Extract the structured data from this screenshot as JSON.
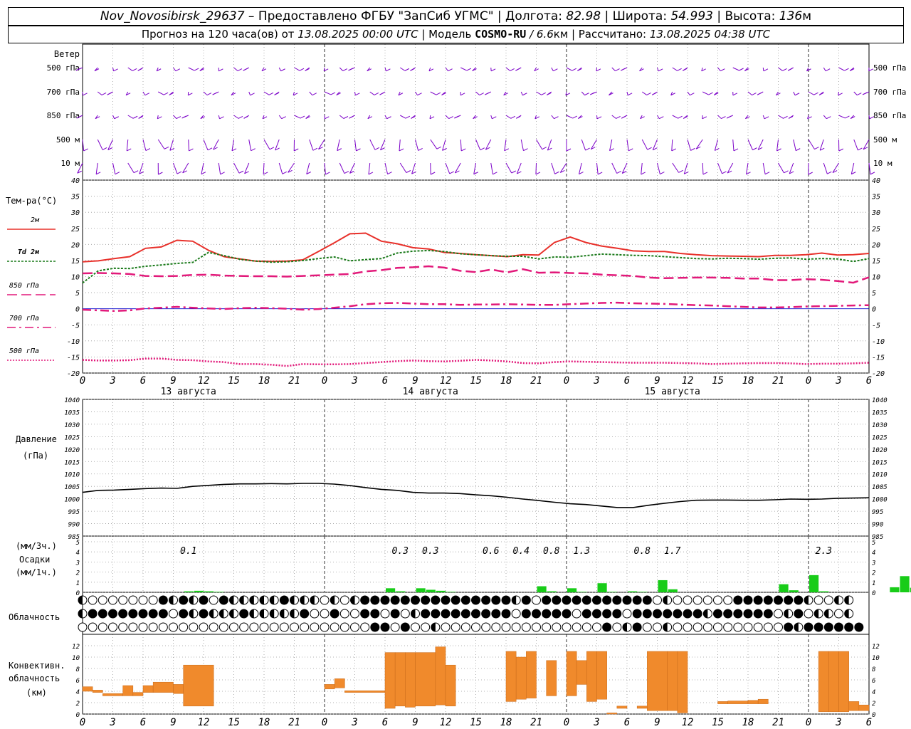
{
  "header": {
    "station": "Nov_Novosibirsk_29637",
    "provider": " – Предоставлено ФГБУ \"ЗапСиб УГМС\" | Долгота: ",
    "lon": "82.98",
    "lat_label": " | Широта: ",
    "lat": "54.993",
    "alt_label": " | Высота: ",
    "alt": "136",
    "alt_unit": "м",
    "line2_a": "Прогноз на 120 часа(ов) от ",
    "forecast_start": "13.08.2025 00:00 UTC",
    "line2_b": "  | Модель ",
    "model": "COSMO-RU",
    "line2_c": " / 6.6",
    "res_unit": "км",
    "line2_d": " | Рассчитано: ",
    "computed": "13.08.2025 04:38 UTC"
  },
  "wind_panel": {
    "title": "Ветер",
    "levels": [
      "500 гПа",
      "700 гПа",
      "850 гПа",
      "500 м",
      "10  м"
    ],
    "color": "#7b00c8"
  },
  "time_axis": {
    "tick_labels": [
      "0",
      "3",
      "6",
      "9",
      "12",
      "15",
      "18",
      "21",
      "0",
      "3",
      "6",
      "9",
      "12",
      "15",
      "18",
      "21",
      "0",
      "3",
      "6",
      "9",
      "12",
      "15",
      "18",
      "21",
      "0",
      "3",
      "6"
    ],
    "dates": [
      "13 августа",
      "14 августа",
      "15 августа"
    ]
  },
  "chart_data": [
    {
      "type": "line",
      "title": "Тем-ра(°C)",
      "x_hours": [
        0,
        6,
        12,
        18,
        24,
        30,
        36,
        42,
        48,
        54,
        60,
        66,
        72,
        78,
        84,
        90,
        96,
        102,
        108,
        114,
        120,
        126,
        132,
        138,
        144,
        150,
        156,
        162,
        168,
        174,
        180,
        186,
        192,
        198,
        204,
        210,
        216,
        222,
        228,
        234,
        240,
        246,
        252,
        258,
        264,
        270,
        276,
        282,
        288,
        294,
        300
      ],
      "ylim": [
        -20,
        40
      ],
      "yticks": [
        -20,
        -15,
        -10,
        -5,
        0,
        5,
        10,
        15,
        20,
        25,
        30,
        35,
        40
      ],
      "series": [
        {
          "name": "2м",
          "color": "#e8302a",
          "dash": "solid",
          "values": [
            14.6,
            14.9,
            15.6,
            16.2,
            18.8,
            19.2,
            21.3,
            21,
            18.2,
            16.2,
            15.5,
            14.8,
            14.7,
            14.8,
            15.2,
            17.8,
            20.5,
            23.3,
            23.5,
            21,
            20.2,
            19,
            18.6,
            17.5,
            17.2,
            16.8,
            16.5,
            16.2,
            16.8,
            16.7,
            20.6,
            22.3,
            20.6,
            19.5,
            18.8,
            18,
            17.8,
            17.8,
            17.2,
            16.8,
            16.5,
            16.4,
            16.3,
            16.2,
            16.6,
            16.6,
            16.8,
            17.3,
            16.7,
            16.8,
            17.2
          ]
        },
        {
          "name": "Td 2м",
          "color": "#1a7a1a",
          "dash": "dashed",
          "values": [
            8,
            11.8,
            12.6,
            12.5,
            13.2,
            13.6,
            14.1,
            14.4,
            17.5,
            16.5,
            15.4,
            14.8,
            14.5,
            14.6,
            15,
            15.6,
            16.1,
            14.9,
            15.3,
            15.6,
            17.3,
            17.9,
            18.1,
            17.8,
            17.1,
            16.8,
            16.5,
            16.3,
            16.3,
            15.5,
            16.1,
            16,
            16.5,
            17,
            16.8,
            16.6,
            16.5,
            16.2,
            15.9,
            15.6,
            15.5,
            15.7,
            15.6,
            15.4,
            15.7,
            15.8,
            15.4,
            15.6,
            15.5,
            14.7,
            15.6
          ]
        },
        {
          "name": "850 гПа",
          "color": "#e2197a",
          "dash": "longdash",
          "values": [
            11,
            11.1,
            11,
            10.8,
            10.2,
            10.1,
            10.2,
            10.5,
            10.6,
            10.3,
            10.2,
            10.1,
            10.1,
            10,
            10.2,
            10.4,
            10.6,
            10.8,
            11.6,
            12,
            12.7,
            12.9,
            13.2,
            12.8,
            11.8,
            11.4,
            12.2,
            11.3,
            12.3,
            11.2,
            11.3,
            11.1,
            11,
            10.6,
            10.4,
            10.2,
            9.7,
            9.5,
            9.6,
            9.7,
            9.7,
            9.6,
            9.4,
            9.4,
            8.9,
            8.9,
            9.2,
            9,
            8.6,
            8.1,
            9.8
          ]
        },
        {
          "name": "700 гПа",
          "color": "#e2197a",
          "dash": "dashdot",
          "values": [
            -0.3,
            -0.5,
            -0.7,
            -0.5,
            0.1,
            0.3,
            0.6,
            0.3,
            0.1,
            -0.1,
            0.2,
            0.3,
            0.2,
            0,
            -0.3,
            -0.1,
            0.3,
            0.8,
            1.4,
            1.7,
            1.8,
            1.6,
            1.4,
            1.4,
            1.2,
            1.3,
            1.3,
            1.4,
            1.3,
            1.2,
            1.2,
            1.4,
            1.6,
            1.8,
            1.9,
            1.7,
            1.6,
            1.5,
            1.3,
            1.1,
            1,
            0.8,
            0.6,
            0.4,
            0.4,
            0.5,
            0.7,
            0.8,
            0.9,
            1,
            1.1
          ]
        },
        {
          "name": "500 гПа",
          "color": "#e2197a",
          "dash": "dotted",
          "values": [
            -15.9,
            -16.1,
            -16.1,
            -16,
            -15.5,
            -15.5,
            -15.9,
            -16,
            -16.4,
            -16.6,
            -17.2,
            -17.2,
            -17.4,
            -17.8,
            -17.2,
            -17.3,
            -17.3,
            -17.2,
            -16.9,
            -16.6,
            -16.3,
            -16.1,
            -16.3,
            -16.4,
            -16.2,
            -15.9,
            -16.1,
            -16.4,
            -16.9,
            -17,
            -16.6,
            -16.4,
            -16.5,
            -16.6,
            -16.7,
            -16.8,
            -16.8,
            -16.8,
            -16.9,
            -17,
            -17.2,
            -17.1,
            -17,
            -16.9,
            -16.9,
            -17,
            -17.2,
            -17.1,
            -17.1,
            -17,
            -16.8
          ]
        }
      ]
    },
    {
      "type": "line",
      "title": "Давление",
      "ylabel": "(гПа)",
      "x_hours": [
        0,
        6,
        12,
        18,
        24,
        30,
        36,
        42,
        48,
        54,
        60,
        66,
        72,
        78,
        84,
        90,
        96,
        102,
        108,
        114,
        120,
        126,
        132,
        138,
        144,
        150,
        156,
        162,
        168,
        174,
        180,
        186,
        192,
        198,
        204,
        210,
        216,
        222,
        228,
        234,
        240,
        246,
        252,
        258,
        264,
        270,
        276,
        282,
        288,
        294,
        300
      ],
      "ylim": [
        985,
        1040
      ],
      "yticks": [
        985,
        990,
        995,
        1000,
        1005,
        1010,
        1015,
        1020,
        1025,
        1030,
        1035,
        1040
      ],
      "series": [
        {
          "name": "",
          "color": "#000000",
          "values": [
            1002.6,
            1003.4,
            1003.5,
            1003.8,
            1004.1,
            1004.3,
            1004.2,
            1005,
            1005.4,
            1005.8,
            1006,
            1006,
            1006.1,
            1006,
            1006.2,
            1006.2,
            1005.9,
            1005.3,
            1004.5,
            1003.8,
            1003.4,
            1002.6,
            1002.3,
            1002.3,
            1002.1,
            1001.6,
            1001.2,
            1000.6,
            999.9,
            999.3,
            998.6,
            998,
            997.7,
            997.1,
            996.5,
            996.5,
            997.4,
            998.2,
            998.9,
            999.4,
            999.5,
            999.5,
            999.4,
            999.4,
            999.6,
            999.9,
            999.8,
            999.9,
            1000.2,
            1000.3,
            1000.4
          ]
        }
      ]
    },
    {
      "type": "bar",
      "title": "Осадки",
      "ylabel": "(мм/3ч.) (мм/1ч.)",
      "ylim": [
        0,
        5
      ],
      "yticks": [
        0,
        1,
        2,
        3,
        4,
        5
      ],
      "color": "#18cc18",
      "bars_hours": [
        10,
        11,
        12,
        13,
        30,
        31,
        33,
        34,
        35,
        36,
        45,
        46,
        48,
        49,
        51,
        52,
        54,
        55,
        57,
        58,
        69,
        70,
        72,
        73,
        80,
        81,
        82,
        83,
        90,
        91,
        93,
        94,
        96,
        97,
        99,
        100
      ],
      "bars_values": [
        0.1,
        0.15,
        0.1,
        0.05,
        0.4,
        0.1,
        0.4,
        0.25,
        0.15,
        0.05,
        0.6,
        0.1,
        0.4,
        0.05,
        0.9,
        0.05,
        0.1,
        0.05,
        1.2,
        0.3,
        0.8,
        0.2,
        1.7,
        0.1,
        0.5,
        1.6,
        0.45,
        0.1,
        0.2,
        0.1,
        0.05,
        0.05,
        0.05,
        0.05,
        0.05,
        0.05
      ],
      "labels_3h": [
        {
          "hour": 10.5,
          "text": "0.1"
        },
        {
          "hour": 31.5,
          "text": "0.3"
        },
        {
          "hour": 34.5,
          "text": "0.3"
        },
        {
          "hour": 40.5,
          "text": "0.6"
        },
        {
          "hour": 43.5,
          "text": "0.4"
        },
        {
          "hour": 46.5,
          "text": "0.8"
        },
        {
          "hour": 49.5,
          "text": "1.3"
        },
        {
          "hour": 55.5,
          "text": "0.8"
        },
        {
          "hour": 58.5,
          "text": "1.7"
        },
        {
          "hour": 73.5,
          "text": "2.3"
        }
      ]
    },
    {
      "type": "bar",
      "title": "Конвективн. облачность",
      "ylabel": "(км)",
      "ylim": [
        0,
        13
      ],
      "yticks": [
        0,
        2,
        4,
        6,
        8,
        10,
        12
      ],
      "color": "#f08a2c",
      "segments_hours": [
        [
          0,
          1
        ],
        [
          1,
          2
        ],
        [
          2,
          4
        ],
        [
          4,
          5
        ],
        [
          5,
          6
        ],
        [
          6,
          7
        ],
        [
          7,
          9
        ],
        [
          9,
          10
        ],
        [
          10,
          13
        ],
        [
          24,
          25
        ],
        [
          25,
          26
        ],
        [
          26,
          30
        ],
        [
          30,
          31
        ],
        [
          31,
          32
        ],
        [
          32,
          33
        ],
        [
          33,
          35
        ],
        [
          35,
          36
        ],
        [
          36,
          37
        ],
        [
          42,
          43
        ],
        [
          43,
          44
        ],
        [
          44,
          45
        ],
        [
          46,
          47
        ],
        [
          48,
          49
        ],
        [
          49,
          50
        ],
        [
          50,
          51
        ],
        [
          51,
          52
        ],
        [
          52,
          53
        ],
        [
          53,
          54
        ],
        [
          55,
          56
        ],
        [
          56,
          58
        ],
        [
          58,
          59
        ],
        [
          59,
          60
        ],
        [
          63,
          64
        ],
        [
          64,
          66
        ],
        [
          66,
          67
        ],
        [
          67,
          68
        ],
        [
          73,
          74
        ],
        [
          74,
          75
        ],
        [
          75,
          76
        ],
        [
          76,
          77
        ],
        [
          77,
          78
        ]
      ],
      "segments_km": [
        [
          4,
          4.8
        ],
        [
          3.8,
          4.2
        ],
        [
          3.2,
          3.6
        ],
        [
          3.2,
          5
        ],
        [
          3.2,
          3.8
        ],
        [
          3.8,
          5
        ],
        [
          3.8,
          5.6
        ],
        [
          3.6,
          5.2
        ],
        [
          1.4,
          8.6
        ],
        [
          4.4,
          5.2
        ],
        [
          4.6,
          6.2
        ],
        [
          3.8,
          4.1
        ],
        [
          1,
          10.8
        ],
        [
          1.4,
          10.8
        ],
        [
          1.2,
          10.8
        ],
        [
          1.4,
          10.8
        ],
        [
          1.6,
          11.8
        ],
        [
          1.4,
          8.6
        ],
        [
          2.2,
          11
        ],
        [
          2.6,
          10
        ],
        [
          2.8,
          11
        ],
        [
          3.2,
          9.4
        ],
        [
          3.2,
          11
        ],
        [
          5.2,
          9.4
        ],
        [
          2.2,
          11
        ],
        [
          2.6,
          11
        ],
        [
          0,
          0.2
        ],
        [
          1,
          1.4
        ],
        [
          1,
          1.4
        ],
        [
          0.6,
          11
        ],
        [
          0.6,
          11
        ],
        [
          0.2,
          11
        ],
        [
          1.8,
          2.2
        ],
        [
          1.8,
          2.3
        ],
        [
          1.8,
          2.4
        ],
        [
          1.8,
          2.6
        ],
        [
          0.4,
          11
        ],
        [
          0.4,
          11
        ],
        [
          0.4,
          11
        ],
        [
          0.6,
          2.2
        ],
        [
          0.6,
          1.6
        ]
      ]
    }
  ],
  "cloudiness": {
    "title": "Облачность",
    "rows": [
      "hqqqqqqqfhfhfqfhhhhhfhhhqhqhfffffffffffffffhfqfffffffffffqhqqqqqqfffffffhqqhh",
      "hffffffffqfhfhhhfhhhhhfqqfqqffqfqhfffffffffqfffffqffffqfffffffhffffffqhfqhhqh",
      "qqqqqqqqqqqqqqqqqqqqqqqqqqqqqffqfqqhqqqqqqqqqqqqqqqqfqhfqqhqqqqqqqqqqqfhffffff"
    ]
  },
  "convective_axis_labels": [
    "0",
    "3",
    "6",
    "9",
    "12",
    "15",
    "18",
    "21",
    "0",
    "3",
    "6",
    "9",
    "12",
    "15",
    "18",
    "21",
    "0",
    "3",
    "6",
    "9",
    "12",
    "15",
    "18",
    "21",
    "0",
    "3",
    "6"
  ]
}
